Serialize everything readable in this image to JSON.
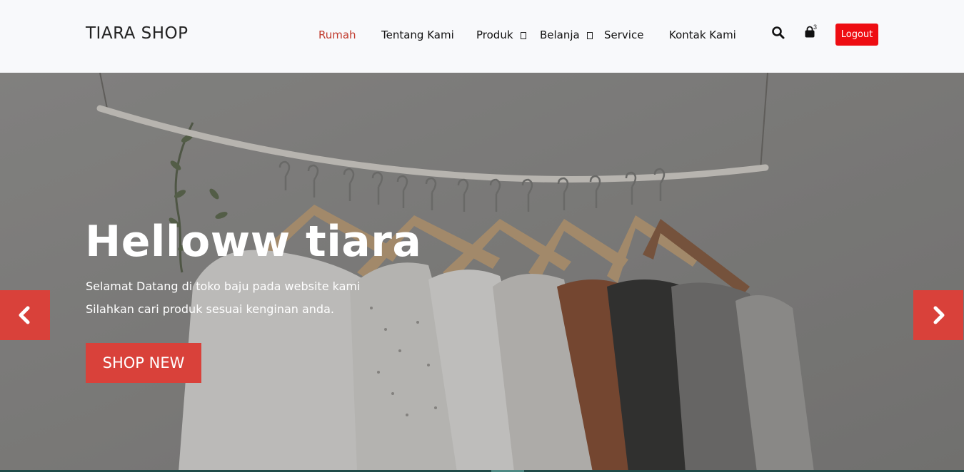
{
  "header": {
    "brand": "TIARA SHOP",
    "nav": [
      {
        "label": "Rumah",
        "active": true
      },
      {
        "label": "Tentang Kami",
        "active": false
      },
      {
        "label": "Produk",
        "active": false,
        "dropdown": true
      },
      {
        "label": "Belanja",
        "active": false,
        "dropdown": true
      },
      {
        "label": "Service",
        "active": false
      },
      {
        "label": "Kontak Kami",
        "active": false
      }
    ],
    "search_icon": "search-icon",
    "cart_icon": "shopping-bag-icon",
    "cart_count": "3",
    "logout_label": "Logout"
  },
  "hero": {
    "title": "Helloww tiara",
    "line1": "Selamat Datang di toko baju pada website kami",
    "line2": "Silahkan cari produk sesuai kenginan anda.",
    "cta_label": "SHOP NEW",
    "prev_icon": "chevron-left-icon",
    "next_icon": "chevron-right-icon"
  },
  "colors": {
    "accent": "#d9413a",
    "active_nav": "#c0392b",
    "logout": "#ee0d12",
    "header_bg": "#f8f9fb"
  }
}
